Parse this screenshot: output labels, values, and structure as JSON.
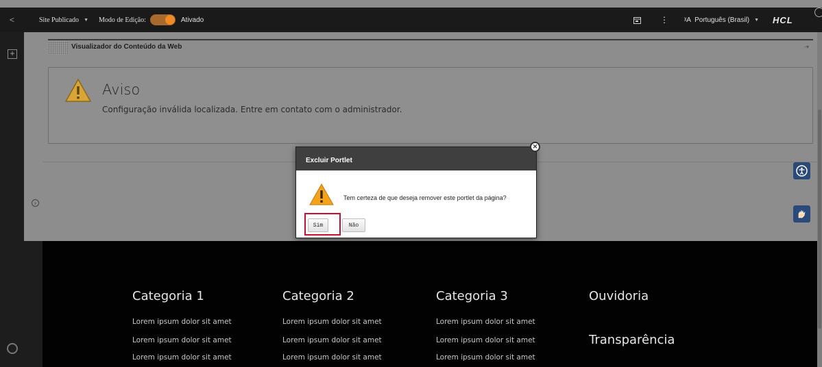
{
  "toolbar": {
    "site_status": "Site Publicado",
    "edit_mode_label": "Modo de Edição:",
    "edit_mode_state": "Ativado",
    "language": "Português (Brasil)",
    "brand": "HCL",
    "more_glyph": "⋮",
    "back_glyph": "<"
  },
  "portlet": {
    "title": "Visualizador do Conteúdo da Web",
    "menu_glyph": "▫▾"
  },
  "alert": {
    "title": "Aviso",
    "message": "Configuração inválida localizada. Entre em contato com o administrador."
  },
  "dialog": {
    "title": "Excluir Portlet",
    "message": "Tem certeza de que deseja remover este portlet da página?",
    "confirm_label": "Sim",
    "cancel_label": "Não",
    "close_glyph": "✕"
  },
  "footer": {
    "columns": [
      {
        "heading": "Categoria 1",
        "links": [
          "Lorem ipsum dolor sit amet",
          "Lorem ipsum dolor sit amet",
          "Lorem ipsum dolor sit amet"
        ]
      },
      {
        "heading": "Categoria 2",
        "links": [
          "Lorem ipsum dolor sit amet",
          "Lorem ipsum dolor sit amet",
          "Lorem ipsum dolor sit amet"
        ]
      },
      {
        "heading": "Categoria 3",
        "links": [
          "Lorem ipsum dolor sit amet",
          "Lorem ipsum dolor sit amet",
          "Lorem ipsum dolor sit amet"
        ]
      }
    ],
    "ouvidoria": "Ouvidoria",
    "transparencia": "Transparência"
  },
  "colors": {
    "toggle_on": "#f08a24",
    "highlight_ring": "#c8102e",
    "accessibility_button": "#2a4a7a"
  },
  "icons": {
    "back": "chevron-left-icon",
    "add": "add-page-icon",
    "help": "help-ring-icon",
    "expand": "arrow-circle-right-icon",
    "calendar": "calendar-icon",
    "translate": "translate-icon",
    "warning": "warning-triangle-icon",
    "accessibility": "accessibility-icon",
    "sign_language": "sign-language-icon"
  }
}
